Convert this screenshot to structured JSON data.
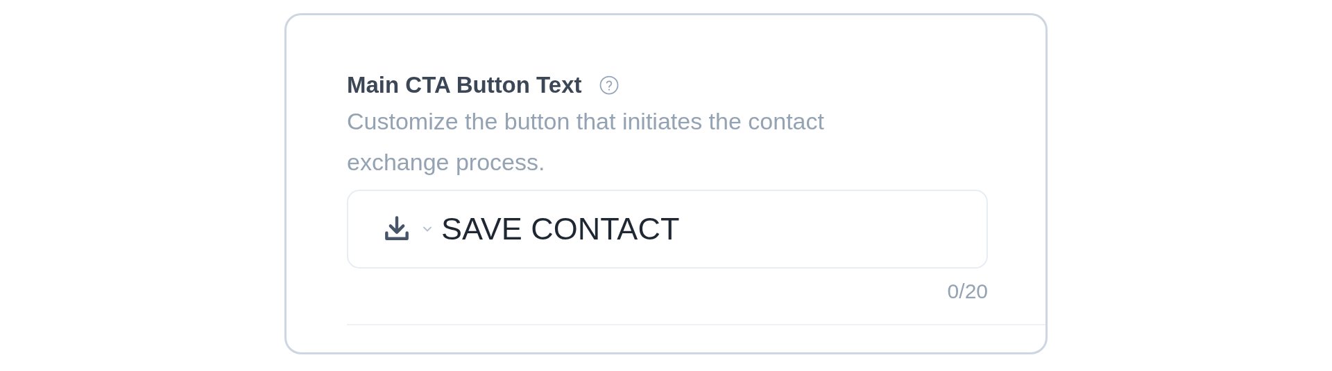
{
  "field": {
    "label": "Main CTA Button Text",
    "description": "Customize the button that initiates the contact exchange process.",
    "value": "SAVE CONTACT",
    "counter": "0/20"
  }
}
